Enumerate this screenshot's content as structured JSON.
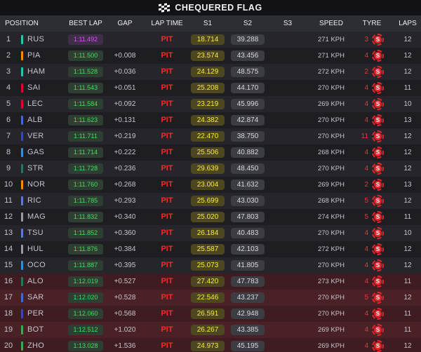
{
  "banner": {
    "title": "CHEQUERED FLAG",
    "icon": "chequered-flag-icon"
  },
  "columns": {
    "position": "POSITION",
    "best_lap": "BEST LAP",
    "gap": "GAP",
    "lap_time": "LAP TIME",
    "s1": "S1",
    "s2": "S2",
    "s3": "S3",
    "speed": "SPEED",
    "tyre": "TYRE",
    "laps": "LAPS"
  },
  "colors": {
    "fastest_lap": "#e14cff",
    "personal_best": "#3fe05a",
    "pit": "#ff2727",
    "s1_highlight": "#f7ea3e",
    "soft_tyre": "#e8242a"
  },
  "rows": [
    {
      "pos": "1",
      "code": "RUS",
      "team_color": "#27c4b0",
      "best_lap": "1:11.492",
      "fastest": true,
      "gap": "",
      "lap_time": "PIT",
      "s1": "18.714",
      "s2": "39.288",
      "s3": "",
      "speed": "271 KPH",
      "tyre_age": "3",
      "tyre": "S",
      "laps": "12",
      "penalty": false
    },
    {
      "pos": "2",
      "code": "PIA",
      "team_color": "#ff8a00",
      "best_lap": "1:11.500",
      "fastest": false,
      "gap": "+0.008",
      "lap_time": "PIT",
      "s1": "23.574",
      "s2": "43.456",
      "s3": "",
      "speed": "271 KPH",
      "tyre_age": "4",
      "tyre": "S",
      "laps": "12",
      "penalty": false
    },
    {
      "pos": "3",
      "code": "HAM",
      "team_color": "#27c4b0",
      "best_lap": "1:11.528",
      "fastest": false,
      "gap": "+0.036",
      "lap_time": "PIT",
      "s1": "24.129",
      "s2": "48.575",
      "s3": "",
      "speed": "272 KPH",
      "tyre_age": "2",
      "tyre": "S",
      "laps": "12",
      "penalty": false
    },
    {
      "pos": "4",
      "code": "SAI",
      "team_color": "#e8002d",
      "best_lap": "1:11.543",
      "fastest": false,
      "gap": "+0.051",
      "lap_time": "PIT",
      "s1": "25.208",
      "s2": "44.170",
      "s3": "",
      "speed": "270 KPH",
      "tyre_age": "4",
      "tyre": "S",
      "laps": "11",
      "penalty": false
    },
    {
      "pos": "5",
      "code": "LEC",
      "team_color": "#e8002d",
      "best_lap": "1:11.584",
      "fastest": false,
      "gap": "+0.092",
      "lap_time": "PIT",
      "s1": "23.219",
      "s2": "45.996",
      "s3": "",
      "speed": "269 KPH",
      "tyre_age": "4",
      "tyre": "S",
      "laps": "10",
      "penalty": false
    },
    {
      "pos": "6",
      "code": "ALB",
      "team_color": "#3a6cd8",
      "best_lap": "1:11.623",
      "fastest": false,
      "gap": "+0.131",
      "lap_time": "PIT",
      "s1": "24.382",
      "s2": "42.874",
      "s3": "",
      "speed": "270 KPH",
      "tyre_age": "4",
      "tyre": "S",
      "laps": "13",
      "penalty": false
    },
    {
      "pos": "7",
      "code": "VER",
      "team_color": "#2f4bb5",
      "best_lap": "1:11.711",
      "fastest": false,
      "gap": "+0.219",
      "lap_time": "PIT",
      "s1": "22.470",
      "s2": "38.750",
      "s3": "",
      "speed": "270 KPH",
      "tyre_age": "11",
      "tyre": "S",
      "laps": "12",
      "penalty": false
    },
    {
      "pos": "8",
      "code": "GAS",
      "team_color": "#2f8fd8",
      "best_lap": "1:11.714",
      "fastest": false,
      "gap": "+0.222",
      "lap_time": "PIT",
      "s1": "25.506",
      "s2": "40.882",
      "s3": "",
      "speed": "268 KPH",
      "tyre_age": "4",
      "tyre": "S",
      "laps": "12",
      "penalty": false
    },
    {
      "pos": "9",
      "code": "STR",
      "team_color": "#1f7a5a",
      "best_lap": "1:11.728",
      "fastest": false,
      "gap": "+0.236",
      "lap_time": "PIT",
      "s1": "29.639",
      "s2": "48.450",
      "s3": "",
      "speed": "270 KPH",
      "tyre_age": "4",
      "tyre": "S",
      "laps": "12",
      "penalty": false
    },
    {
      "pos": "10",
      "code": "NOR",
      "team_color": "#ff8a00",
      "best_lap": "1:11.760",
      "fastest": false,
      "gap": "+0.268",
      "lap_time": "PIT",
      "s1": "23.004",
      "s2": "41.632",
      "s3": "",
      "speed": "269 KPH",
      "tyre_age": "2",
      "tyre": "S",
      "laps": "13",
      "penalty": false
    },
    {
      "pos": "11",
      "code": "RIC",
      "team_color": "#5b7bd6",
      "best_lap": "1:11.785",
      "fastest": false,
      "gap": "+0.293",
      "lap_time": "PIT",
      "s1": "25.699",
      "s2": "43.030",
      "s3": "",
      "speed": "268 KPH",
      "tyre_age": "5",
      "tyre": "S",
      "laps": "12",
      "penalty": false
    },
    {
      "pos": "12",
      "code": "MAG",
      "team_color": "#9a9aa2",
      "best_lap": "1:11.832",
      "fastest": false,
      "gap": "+0.340",
      "lap_time": "PIT",
      "s1": "25.020",
      "s2": "47.803",
      "s3": "",
      "speed": "274 KPH",
      "tyre_age": "5",
      "tyre": "S",
      "laps": "11",
      "penalty": false
    },
    {
      "pos": "13",
      "code": "TSU",
      "team_color": "#5b7bd6",
      "best_lap": "1:11.852",
      "fastest": false,
      "gap": "+0.360",
      "lap_time": "PIT",
      "s1": "26.184",
      "s2": "40.483",
      "s3": "",
      "speed": "270 KPH",
      "tyre_age": "4",
      "tyre": "S",
      "laps": "10",
      "penalty": false
    },
    {
      "pos": "14",
      "code": "HUL",
      "team_color": "#9a9aa2",
      "best_lap": "1:11.876",
      "fastest": false,
      "gap": "+0.384",
      "lap_time": "PIT",
      "s1": "25.587",
      "s2": "42.103",
      "s3": "",
      "speed": "272 KPH",
      "tyre_age": "4",
      "tyre": "S",
      "laps": "12",
      "penalty": false
    },
    {
      "pos": "15",
      "code": "OCO",
      "team_color": "#2f8fd8",
      "best_lap": "1:11.887",
      "fastest": false,
      "gap": "+0.395",
      "lap_time": "PIT",
      "s1": "25.073",
      "s2": "41.805",
      "s3": "",
      "speed": "270 KPH",
      "tyre_age": "4",
      "tyre": "S",
      "laps": "12",
      "penalty": false
    },
    {
      "pos": "16",
      "code": "ALO",
      "team_color": "#1f7a5a",
      "best_lap": "1:12.019",
      "fastest": false,
      "gap": "+0.527",
      "lap_time": "PIT",
      "s1": "27.420",
      "s2": "47.783",
      "s3": "",
      "speed": "273 KPH",
      "tyre_age": "4",
      "tyre": "S",
      "laps": "11",
      "penalty": true
    },
    {
      "pos": "17",
      "code": "SAR",
      "team_color": "#3a6cd8",
      "best_lap": "1:12.020",
      "fastest": false,
      "gap": "+0.528",
      "lap_time": "PIT",
      "s1": "22.546",
      "s2": "43.237",
      "s3": "",
      "speed": "270 KPH",
      "tyre_age": "5",
      "tyre": "S",
      "laps": "12",
      "penalty": true
    },
    {
      "pos": "18",
      "code": "PER",
      "team_color": "#2f4bb5",
      "best_lap": "1:12.060",
      "fastest": false,
      "gap": "+0.568",
      "lap_time": "PIT",
      "s1": "26.591",
      "s2": "42.948",
      "s3": "",
      "speed": "270 KPH",
      "tyre_age": "4",
      "tyre": "S",
      "laps": "11",
      "penalty": true
    },
    {
      "pos": "19",
      "code": "BOT",
      "team_color": "#3fa848",
      "best_lap": "1:12.512",
      "fastest": false,
      "gap": "+1.020",
      "lap_time": "PIT",
      "s1": "26.267",
      "s2": "43.385",
      "s3": "",
      "speed": "269 KPH",
      "tyre_age": "4",
      "tyre": "S",
      "laps": "11",
      "penalty": true
    },
    {
      "pos": "20",
      "code": "ZHO",
      "team_color": "#3fa848",
      "best_lap": "1:13.028",
      "fastest": false,
      "gap": "+1.536",
      "lap_time": "PIT",
      "s1": "24.973",
      "s2": "45.195",
      "s3": "",
      "speed": "269 KPH",
      "tyre_age": "4",
      "tyre": "S",
      "laps": "12",
      "penalty": true
    }
  ]
}
